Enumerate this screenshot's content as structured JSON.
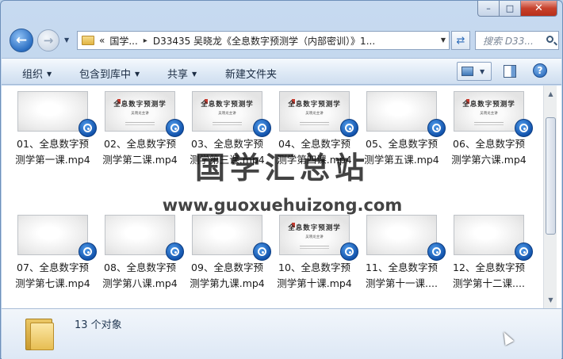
{
  "window": {
    "minimize": "–",
    "maximize": "□",
    "close": "✕"
  },
  "nav": {
    "back": "←",
    "forward": "→",
    "address_chevron": "«",
    "address_root": "国学...",
    "address_sep": "▸",
    "address_folder": "D33435 吴晓龙《全息数字预测学（内部密训）》1...",
    "search_placeholder": "搜索 D33..."
  },
  "toolbar": {
    "organize": "组织",
    "include_library": "包含到库中",
    "share": "共享",
    "new_folder": "新建文件夹"
  },
  "files": [
    {
      "line1": "01、全息数字预",
      "line2": "测学第一课.mp4",
      "thumb": "blank"
    },
    {
      "line1": "02、全息数字预",
      "line2": "测学第二课.mp4",
      "thumb": "title"
    },
    {
      "line1": "03、全息数字预",
      "line2": "测学第三课.mp4",
      "thumb": "title"
    },
    {
      "line1": "04、全息数字预",
      "line2": "测学第四课.mp4",
      "thumb": "title"
    },
    {
      "line1": "05、全息数字预",
      "line2": "测学第五课.mp4",
      "thumb": "blank"
    },
    {
      "line1": "06、全息数字预",
      "line2": "测学第六课.mp4",
      "thumb": "title"
    },
    {
      "line1": "07、全息数字预",
      "line2": "测学第七课.mp4",
      "thumb": "blank"
    },
    {
      "line1": "08、全息数字预",
      "line2": "测学第八课.mp4",
      "thumb": "blank"
    },
    {
      "line1": "09、全息数字预",
      "line2": "测学第九课.mp4",
      "thumb": "blank"
    },
    {
      "line1": "10、全息数字预",
      "line2": "测学第十课.mp4",
      "thumb": "title"
    },
    {
      "line1": "11、全息数字预",
      "line2": "测学第十一课....",
      "thumb": "blank"
    },
    {
      "line1": "12、全息数字预",
      "line2": "测学第十二课....",
      "thumb": "blank"
    }
  ],
  "slide": {
    "title": "全息数字预测学",
    "subtitle": "吴晓龙主讲"
  },
  "watermark": {
    "chinese": "国学汇总站",
    "url": "www.guoxuehuizong.com"
  },
  "details": {
    "count": "13 个对象"
  },
  "colors": {
    "accent": "#2c6fc2",
    "close_red": "#c7412c"
  }
}
